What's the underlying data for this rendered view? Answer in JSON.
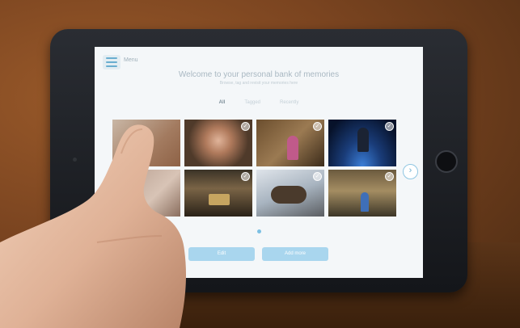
{
  "screen": {
    "menu_label": "Menu",
    "title": "Welcome to your personal bank of memories",
    "subtitle": "Browse, tag and revisit your memories here",
    "tabs": [
      {
        "label": "All",
        "active": true
      },
      {
        "label": "Tagged",
        "active": false
      },
      {
        "label": "Recently",
        "active": false
      }
    ],
    "photos": [
      {
        "name": "photo-hand-covered",
        "checked": false
      },
      {
        "name": "photo-woman-portrait",
        "checked": true
      },
      {
        "name": "photo-woman-standing",
        "checked": true
      },
      {
        "name": "photo-space-figure",
        "checked": true
      },
      {
        "name": "photo-baby",
        "checked": false
      },
      {
        "name": "photo-trophy",
        "checked": true
      },
      {
        "name": "photo-cat-sleeping",
        "checked": true
      },
      {
        "name": "photo-church-interior",
        "checked": true
      }
    ],
    "next_icon": "chevron-right-icon",
    "pagination_dots": 1,
    "buttons": {
      "edit": "Edit",
      "add": "Add more"
    }
  },
  "colors": {
    "accent": "#6aaed0",
    "button": "#a9d6ee",
    "screen_bg": "#f4f7f9"
  }
}
